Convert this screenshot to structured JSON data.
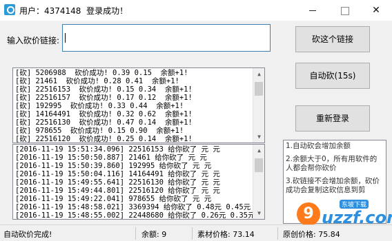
{
  "window": {
    "title": "用户：4374148  登录成功！",
    "minimize_label": "",
    "maximize_label": "",
    "close_label": "✕"
  },
  "input": {
    "label": "输入砍价链接:",
    "value": ""
  },
  "buttons": {
    "cut": "砍这个链接",
    "auto": "自动砍(15s)",
    "relogin": "重新登录"
  },
  "log_top": [
    "[砍] 5206988  砍价成功! 0.39 0.15  余额+1!",
    "[砍] 21461  砍价成功! 0.28 0.41  余额+1!",
    "[砍] 22516153  砍价成功! 0.15 0.34  余额+1!",
    "[砍] 22516157  砍价成功! 0.17 0.12  余额+1!",
    "[砍] 192995  砍价成功! 0.33 0.44  余额+1!",
    "[砍] 14164491  砍价成功! 0.32 0.62  余额+1!",
    "[砍] 22516130  砍价成功! 0.47 0.14  余额+1!",
    "[砍] 978655  砍价成功! 0.15 0.90  余额+1!",
    "[砍] 22516120  砍价成功! 0.25 0.14  余额+1!"
  ],
  "log_bottom": [
    "[2016-11-19 15:51:34.096] 22516153 给你砍了 元 元",
    "[2016-11-19 15:50:50.887] 21461 给你砍了 元 元",
    "[2016-11-19 15:50:39.860] 192995 给你砍了 元 元",
    "[2016-11-19 15:50:04.116] 14164491 给你砍了 元 元",
    "[2016-11-19 15:49:55.641] 22516130 给你砍了 元 元",
    "[2016-11-19 15:49:44.801] 22516120 给你砍了 元 元",
    "[2016-11-19 15:49:22.041] 978655 给你砍了 元 元",
    "[2016-11-19 15:48:58.021] 3369394 给你砍了 0.48元 0.45元",
    "[2016-11-19 15:48:55.002] 22448680 给你砍了 0.26元 0.35元"
  ],
  "info": [
    "1.自动砍会增加余额",
    "2.余额大于0，所有用软件的人都会帮你砍价",
    "3.砍链接不会增加余额，砍价成功会复制这砍信息到剪"
  ],
  "watermark": {
    "letter": "9",
    "text": "uzzf.com",
    "tag": "东坡下载"
  },
  "status": {
    "message": "自动砍价完成!",
    "balance": "余额: 9",
    "material_price": "素材价格: 73.14",
    "original_price": "原创价格: 75.84"
  },
  "colors": {
    "window_bg": "#f0f0f0",
    "titlebar_bg": "#ffffff",
    "input_border": "#3c7fb1",
    "button_bg": "#e1e1e1",
    "watermark_orange": "#ff7a1a",
    "watermark_blue": "#2d8fe0"
  }
}
